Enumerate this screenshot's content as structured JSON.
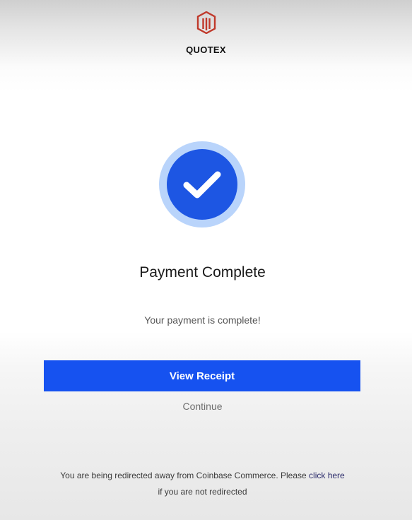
{
  "brand": {
    "name": "QUOTEX",
    "logo_icon": "quotex-logo-icon",
    "logo_color": "#c0392b"
  },
  "status": {
    "icon": "checkmark-icon",
    "icon_color": "#1d56e3",
    "ring_color": "#b9d4fb",
    "title": "Payment Complete",
    "message": "Your payment is complete!"
  },
  "actions": {
    "view_receipt_label": "View Receipt",
    "button_color": "#1652f0",
    "continue_label": "Continue"
  },
  "redirect": {
    "text_before": "You are being redirected away from Coinbase Commerce. Please",
    "link_label": "click here",
    "text_after": "if you are not redirected"
  }
}
